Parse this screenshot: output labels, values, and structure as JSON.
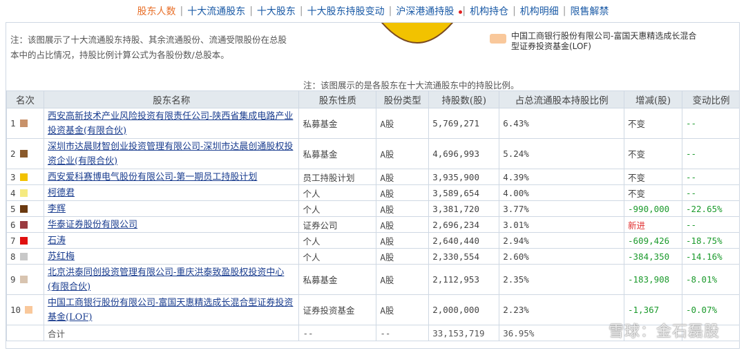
{
  "nav": {
    "tabs": [
      "股东人数",
      "十大流通股东",
      "十大股东",
      "十大股东持股变动",
      "沪深港通持股",
      "机构持仓",
      "机构明细",
      "限售解禁"
    ],
    "active_index": 0
  },
  "note_left": "注：该图展示了十大流通股东持股、其余流通股份、流通受限股份在总股本中的占比情况，持股比例计算公式为各股份数/总股本。",
  "legend_label": "中国工商银行股份有限公司-富国天惠精选成长混合型证券投资基金(LOF)",
  "note_right": "注：该图展示的是各股东在十大流通股东中的持股比例。",
  "table": {
    "headers": [
      "名次",
      "股东名称",
      "股东性质",
      "股份类型",
      "持股数(股)",
      "占总流通股本持股比例",
      "增减(股)",
      "变动比例"
    ],
    "rows": [
      {
        "rank": "1",
        "color": "#c8926a",
        "name": "西安高新技术产业风险投资有限责任公司-陕西省集成电路产业投资基金(有限合伙)",
        "nature": "私募基金",
        "type": "A股",
        "shares": "5,769,271",
        "ratio": "6.43%",
        "change": "不变",
        "pct": "--"
      },
      {
        "rank": "2",
        "color": "#8a5a2b",
        "name": "深圳市达晨财智创业投资管理有限公司-深圳市达晨创通股权投资企业(有限合伙)",
        "nature": "私募基金",
        "type": "A股",
        "shares": "4,696,993",
        "ratio": "5.24%",
        "change": "不变",
        "pct": "--"
      },
      {
        "rank": "3",
        "color": "#f2c200",
        "name": "西安爱科赛博电气股份有限公司-第一期员工持股计划",
        "nature": "员工持股计划",
        "type": "A股",
        "shares": "3,935,900",
        "ratio": "4.39%",
        "change": "不变",
        "pct": "--"
      },
      {
        "rank": "4",
        "color": "#f5ea80",
        "name": "柯德君",
        "nature": "个人",
        "type": "A股",
        "shares": "3,589,654",
        "ratio": "4.00%",
        "change": "不变",
        "pct": "--"
      },
      {
        "rank": "5",
        "color": "#6b3a10",
        "name": "李辉",
        "nature": "个人",
        "type": "A股",
        "shares": "3,381,720",
        "ratio": "3.77%",
        "change": "-990,000",
        "pct": "-22.65%"
      },
      {
        "rank": "6",
        "color": "#9a3a40",
        "name": "华泰证券股份有限公司",
        "nature": "证券公司",
        "type": "A股",
        "shares": "2,696,234",
        "ratio": "3.01%",
        "change": "新进",
        "pct": "--"
      },
      {
        "rank": "7",
        "color": "#e01010",
        "name": "石涛",
        "nature": "个人",
        "type": "A股",
        "shares": "2,640,440",
        "ratio": "2.94%",
        "change": "-609,426",
        "pct": "-18.75%"
      },
      {
        "rank": "8",
        "color": "#c8c8c8",
        "name": "苏红梅",
        "nature": "个人",
        "type": "A股",
        "shares": "2,330,554",
        "ratio": "2.60%",
        "change": "-384,350",
        "pct": "-14.16%"
      },
      {
        "rank": "9",
        "color": "#d8c4b0",
        "name": "北京洪泰同创投资管理有限公司-重庆洪泰致盈股权投资中心(有限合伙)",
        "nature": "私募基金",
        "type": "A股",
        "shares": "2,112,953",
        "ratio": "2.35%",
        "change": "-183,908",
        "pct": "-8.01%"
      },
      {
        "rank": "10",
        "color": "#f9c89b",
        "name": "中国工商银行股份有限公司-富国天惠精选成长混合型证券投资基金(LOF)",
        "nature": "证券投资基金",
        "type": "A股",
        "shares": "2,000,000",
        "ratio": "2.23%",
        "change": "-1,367",
        "pct": "-0.07%"
      }
    ],
    "total": {
      "label": "合计",
      "nature": "--",
      "type": "--",
      "shares": "33,153,719",
      "ratio": "36.95%"
    }
  },
  "watermark": "雪球：金石磊股"
}
